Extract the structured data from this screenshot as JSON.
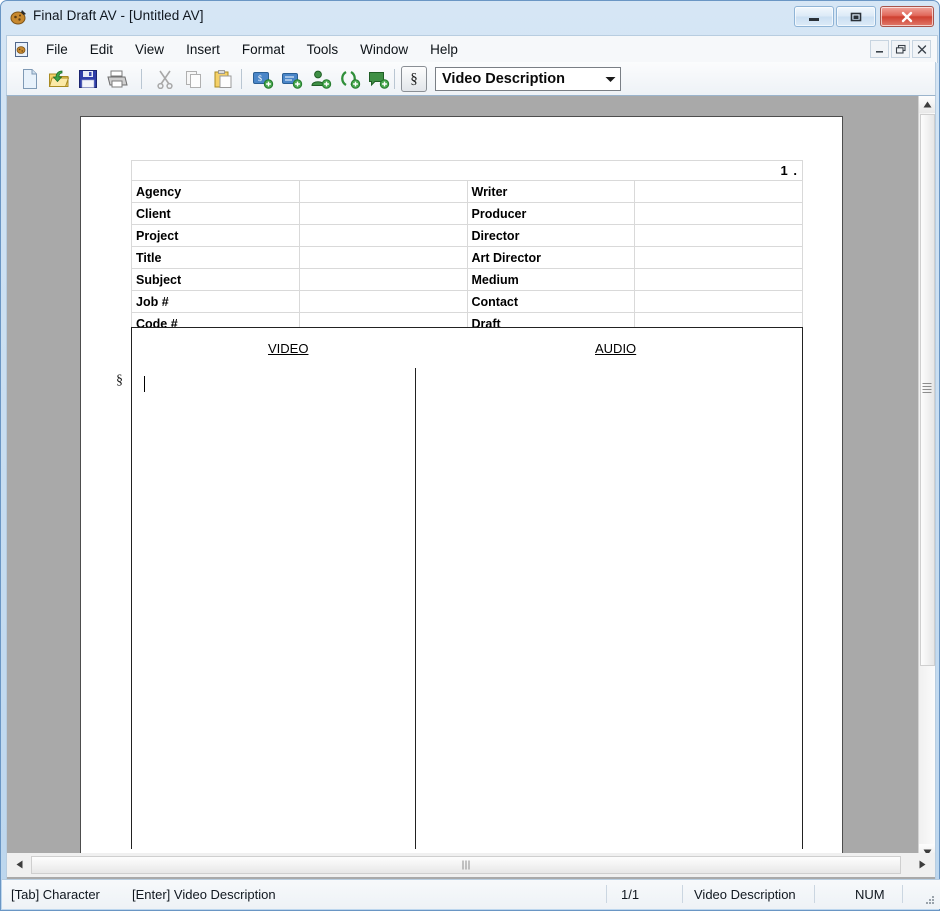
{
  "window": {
    "title": "Final Draft AV - [Untitled AV]",
    "app_icon": "finaldraft-app-icon",
    "caption_buttons": {
      "minimize": "minimize-icon",
      "maximize": "maximize-icon",
      "close": "close-icon"
    },
    "mdi_buttons": {
      "minimize": "–",
      "restore": "❐",
      "close": "✕"
    }
  },
  "menubar": {
    "doc_icon": "document-window-icon",
    "items": [
      {
        "label": "File"
      },
      {
        "label": "Edit"
      },
      {
        "label": "View"
      },
      {
        "label": "Insert"
      },
      {
        "label": "Format"
      },
      {
        "label": "Tools"
      },
      {
        "label": "Window"
      },
      {
        "label": "Help"
      }
    ]
  },
  "toolbar": {
    "buttons": [
      {
        "name": "new-document-icon",
        "tip": "New"
      },
      {
        "name": "open-folder-icon",
        "tip": "Open"
      },
      {
        "name": "save-floppy-icon",
        "tip": "Save"
      },
      {
        "name": "print-icon",
        "tip": "Print"
      },
      {
        "name": "cut-scissors-icon",
        "tip": "Cut"
      },
      {
        "name": "copy-icon",
        "tip": "Copy"
      },
      {
        "name": "paste-clipboard-icon",
        "tip": "Paste"
      },
      {
        "name": "add-scenecard-icon",
        "tip": "Add ScriptNote"
      },
      {
        "name": "add-note-icon",
        "tip": "Add Note"
      },
      {
        "name": "add-character-icon",
        "tip": "Add Character"
      },
      {
        "name": "revision-icon",
        "tip": "Revision"
      },
      {
        "name": "add-comment-icon",
        "tip": "Add Comment"
      }
    ],
    "paragraph_button": {
      "name": "paragraph-mark-button",
      "glyph": "§"
    },
    "element_combo": {
      "value": "Video Description",
      "arrow": "chevron-down-icon"
    }
  },
  "document": {
    "page_number": "1 .",
    "header_rows": [
      {
        "left_label": "Agency",
        "left_value": "",
        "right_label": "Writer",
        "right_value": ""
      },
      {
        "left_label": "Client",
        "left_value": "",
        "right_label": "Producer",
        "right_value": ""
      },
      {
        "left_label": "Project",
        "left_value": "",
        "right_label": "Director",
        "right_value": ""
      },
      {
        "left_label": "Title",
        "left_value": "",
        "right_label": "Art Director",
        "right_value": ""
      },
      {
        "left_label": "Subject",
        "left_value": "",
        "right_label": "Medium",
        "right_value": ""
      },
      {
        "left_label": "Job #",
        "left_value": "",
        "right_label": "Contact",
        "right_value": ""
      },
      {
        "left_label": "Code #",
        "left_value": "",
        "right_label": "Draft",
        "right_value": ""
      }
    ],
    "columns": {
      "video_header": "VIDEO",
      "audio_header": "AUDIO"
    },
    "video_text": "",
    "audio_text": "",
    "paragraph_marker": "§"
  },
  "scrollbars": {
    "vertical": {
      "up": "scroll-up-arrow-icon",
      "down": "scroll-down-arrow-icon"
    },
    "horizontal": {
      "left": "scroll-left-arrow-icon",
      "right": "scroll-right-arrow-icon"
    }
  },
  "statusbar": {
    "tab_hint": "[Tab] Character",
    "enter_hint": "[Enter] Video Description",
    "page_count": "1/1",
    "element": "Video Description",
    "num_lock": "NUM"
  },
  "colors": {
    "frame": "#bcd6ee",
    "workspace": "#a9a9a9",
    "page": "#ffffff",
    "table_grid": "#d9d9d9",
    "table_border": "#222222",
    "close_button": "#cf4030"
  }
}
